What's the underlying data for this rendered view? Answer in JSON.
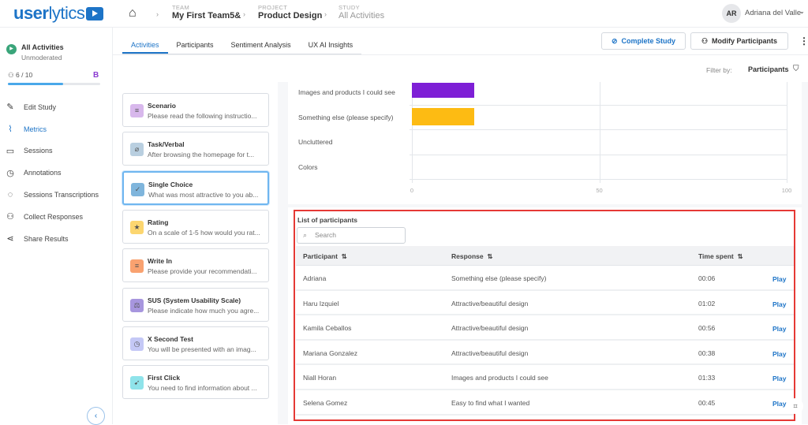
{
  "header": {
    "logo": "userlytics",
    "breadcrumbs": [
      {
        "key": "TEAM",
        "value": "My First Team5&"
      },
      {
        "key": "PROJECT",
        "value": "Product Design"
      },
      {
        "key": "STUDY",
        "value": "All Activities"
      }
    ],
    "user": {
      "initials": "AR",
      "name": "Adriana del Valle"
    }
  },
  "sidebar": {
    "study_title": "All Activities",
    "study_type": "Unmoderated",
    "participants": "6 / 10",
    "participants_progress": 0.6,
    "badge": "B",
    "items": [
      {
        "label": "Edit Study",
        "icon": "pencil-icon"
      },
      {
        "label": "Metrics",
        "icon": "chart-icon",
        "active": true
      },
      {
        "label": "Sessions",
        "icon": "video-icon"
      },
      {
        "label": "Annotations",
        "icon": "clock-icon"
      },
      {
        "label": "Sessions Transcriptions",
        "icon": "chat-icon"
      },
      {
        "label": "Collect Responses",
        "icon": "users-icon"
      },
      {
        "label": "Share Results",
        "icon": "share-icon"
      }
    ]
  },
  "tabs": [
    {
      "label": "Activities",
      "active": true
    },
    {
      "label": "Participants"
    },
    {
      "label": "Sentiment Analysis"
    },
    {
      "label": "UX AI Insights"
    }
  ],
  "actions": {
    "complete": "Complete Study",
    "modify": "Modify Participants"
  },
  "filter": {
    "label": "Filter by:",
    "value": "Participants"
  },
  "activities": [
    {
      "title": "Scenario",
      "desc": "Please read the following instructio...",
      "color": "#d8b8ec",
      "icon": "≡"
    },
    {
      "title": "Task/Verbal",
      "desc": "After browsing the homepage for t...",
      "color": "#b9cfe0",
      "icon": "⌀"
    },
    {
      "title": "Single Choice",
      "desc": "What was most attractive to you ab...",
      "color": "#7fb5dc",
      "icon": "✓",
      "selected": true
    },
    {
      "title": "Rating",
      "desc": "On a scale of 1-5 how would you rat...",
      "color": "#fcd670",
      "icon": "★"
    },
    {
      "title": "Write In",
      "desc": "Please provide your recommendati...",
      "color": "#f9a270",
      "icon": "≡"
    },
    {
      "title": "SUS (System Usability Scale)",
      "desc": "Please indicate how much you agre...",
      "color": "#a796de",
      "icon": "⚖"
    },
    {
      "title": "X Second Test",
      "desc": "You will be presented with an imag...",
      "color": "#c4c8f6",
      "icon": "◷"
    },
    {
      "title": "First Click",
      "desc": "You need to find information about ...",
      "color": "#8fe3ea",
      "icon": "➹"
    }
  ],
  "chart_data": {
    "type": "bar",
    "orientation": "horizontal",
    "categories": [
      "Images and products I could see",
      "Something else (please specify)",
      "Uncluttered",
      "Colors"
    ],
    "values": [
      16.7,
      16.7,
      0,
      0
    ],
    "colors": [
      "#7e1fd6",
      "#fdbb13",
      "#cccccc",
      "#cccccc"
    ],
    "xlim": [
      0,
      100
    ],
    "xticks": [
      "0",
      "50",
      "100"
    ],
    "grid": true
  },
  "participants_list": {
    "title": "List of participants",
    "search_placeholder": "Search",
    "columns": [
      "Participant",
      "Response",
      "Time spent"
    ],
    "play_label": "Play",
    "rows": [
      [
        "Adriana",
        "Something else (please specify)",
        "00:06"
      ],
      [
        "Haru Izquiel",
        "Attractive/beautiful design",
        "01:02"
      ],
      [
        "Kamila Ceballos",
        "Attractive/beautiful design",
        "00:56"
      ],
      [
        "Mariana Gonzalez",
        "Attractive/beautiful design",
        "00:38"
      ],
      [
        "Niall Horan",
        "Images and products I could see",
        "01:33"
      ],
      [
        "Selena Gomez",
        "Easy to find what I wanted",
        "00:45"
      ]
    ]
  }
}
